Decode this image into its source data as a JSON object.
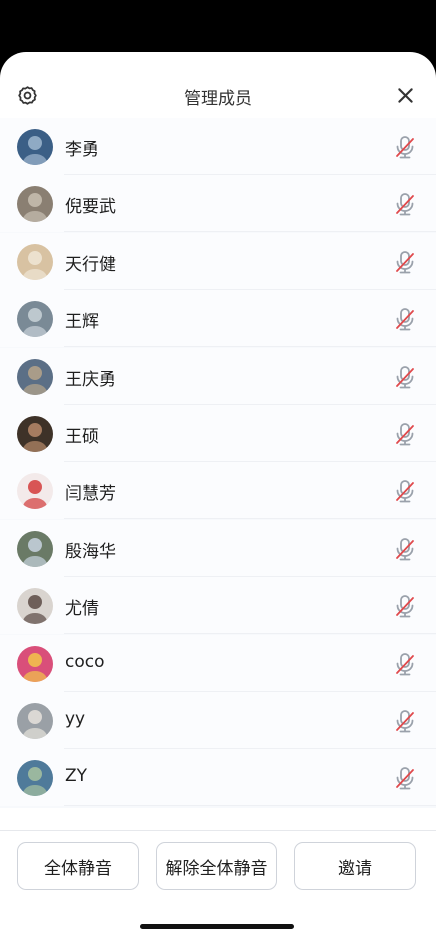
{
  "header": {
    "title": "管理成员"
  },
  "members": [
    {
      "name": "李勇",
      "avatar": {
        "bg": "#3b5f86",
        "fg": "#9fb7cf"
      }
    },
    {
      "name": "倪要武",
      "avatar": {
        "bg": "#8a7f72",
        "fg": "#c8bfb2"
      }
    },
    {
      "name": "天行健",
      "avatar": {
        "bg": "#d8c2a2",
        "fg": "#f0e6d6"
      }
    },
    {
      "name": "王辉",
      "avatar": {
        "bg": "#7a8a96",
        "fg": "#c9d2d8"
      }
    },
    {
      "name": "王庆勇",
      "avatar": {
        "bg": "#5b6f86",
        "fg": "#b7a58a"
      }
    },
    {
      "name": "王硕",
      "avatar": {
        "bg": "#3e3228",
        "fg": "#b88a6a"
      }
    },
    {
      "name": "闫慧芳",
      "avatar": {
        "bg": "#f3eaea",
        "fg": "#d23b3b"
      }
    },
    {
      "name": "殷海华",
      "avatar": {
        "bg": "#6a7a66",
        "fg": "#c8d4e0"
      }
    },
    {
      "name": "尤倩",
      "avatar": {
        "bg": "#d9d4cf",
        "fg": "#5a4a44"
      }
    },
    {
      "name": "coco",
      "avatar": {
        "bg": "#d94f7a",
        "fg": "#f2c64a"
      }
    },
    {
      "name": "yy",
      "avatar": {
        "bg": "#9aa0a6",
        "fg": "#e6e2dc"
      }
    },
    {
      "name": "ZY",
      "avatar": {
        "bg": "#4f7a9a",
        "fg": "#a7c2a0"
      }
    }
  ],
  "buttons": {
    "mute_all": "全体静音",
    "unmute_all": "解除全体静音",
    "invite": "邀请"
  },
  "colors": {
    "mic_muted_slash": "#e0494c",
    "mic_body": "#9aa1ab"
  },
  "icons": {
    "settings": "gear-icon",
    "close": "close-icon",
    "mic": "mic-muted-icon"
  }
}
